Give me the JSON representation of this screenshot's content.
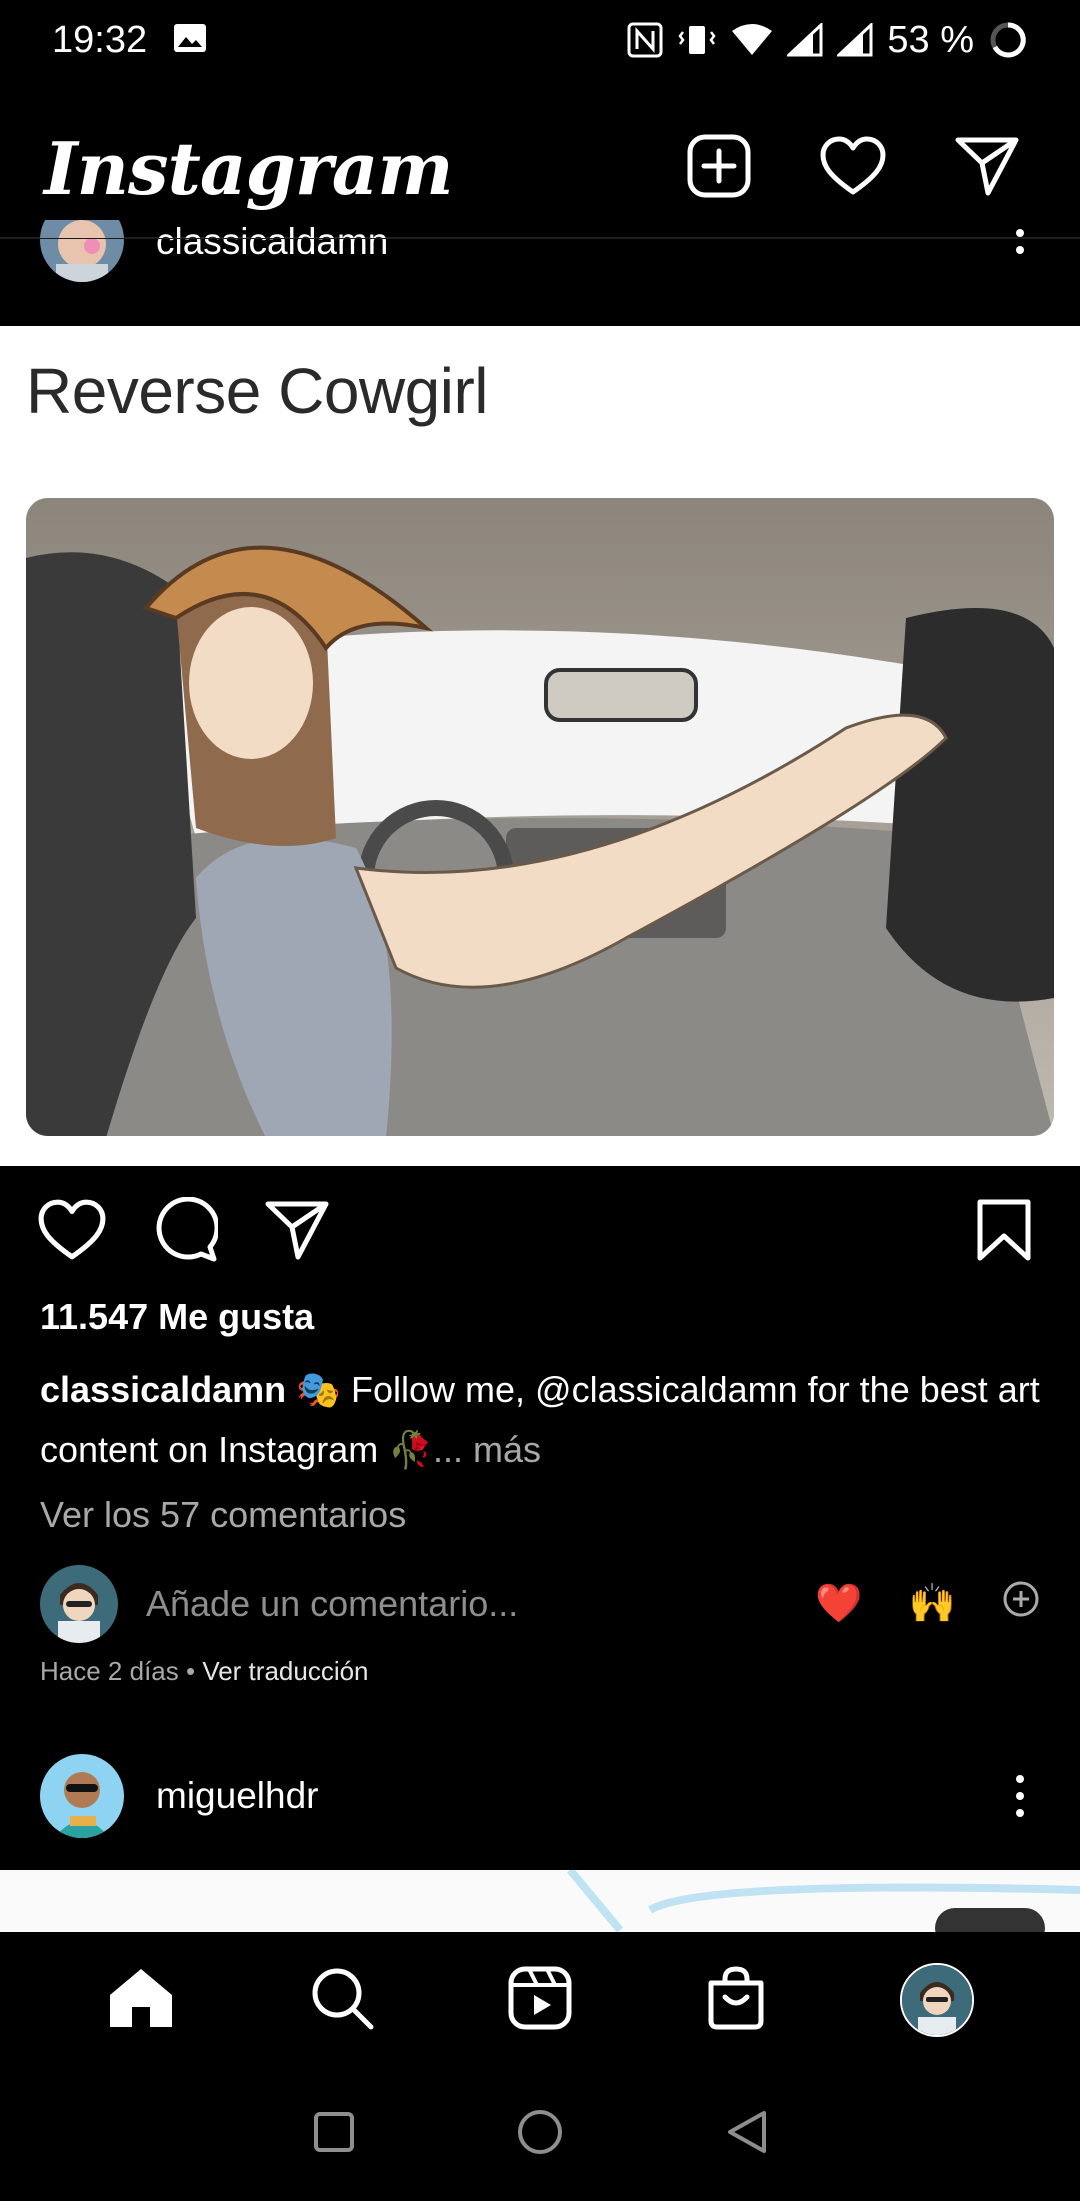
{
  "status_bar": {
    "time": "19:32",
    "battery": "53 %",
    "icons": [
      "image-icon",
      "nfc-icon",
      "vibrate-icon",
      "wifi-icon",
      "signal-icon",
      "signal-icon",
      "battery-icon"
    ]
  },
  "header": {
    "logo": "Instagram",
    "actions": [
      "new-post-icon",
      "heart-icon",
      "direct-message-icon"
    ]
  },
  "post": {
    "username": "classicaldamn",
    "image_caption": "Reverse Cowgirl",
    "likes": "11.547 Me gusta",
    "caption_user": "classicaldamn",
    "caption_text": " 🎭 Follow me, @classicaldamn for the best art content on Instagram 🥀",
    "caption_more": "... más",
    "view_comments": "Ver los 57 comentarios",
    "comment_placeholder": "Añade un comentario...",
    "quick_reactions": [
      "❤️",
      "🙌"
    ],
    "time_ago": "Hace 2 días",
    "separator": " • ",
    "translate": "Ver traducción"
  },
  "next_post": {
    "username": "miguelhdr"
  },
  "bottom_nav": [
    "home-icon",
    "search-icon",
    "reels-icon",
    "shop-icon",
    "profile-avatar"
  ],
  "colors": {
    "background": "#000000",
    "secondary_text": "#a8a8a8",
    "heart_red": "#ed1c24"
  }
}
